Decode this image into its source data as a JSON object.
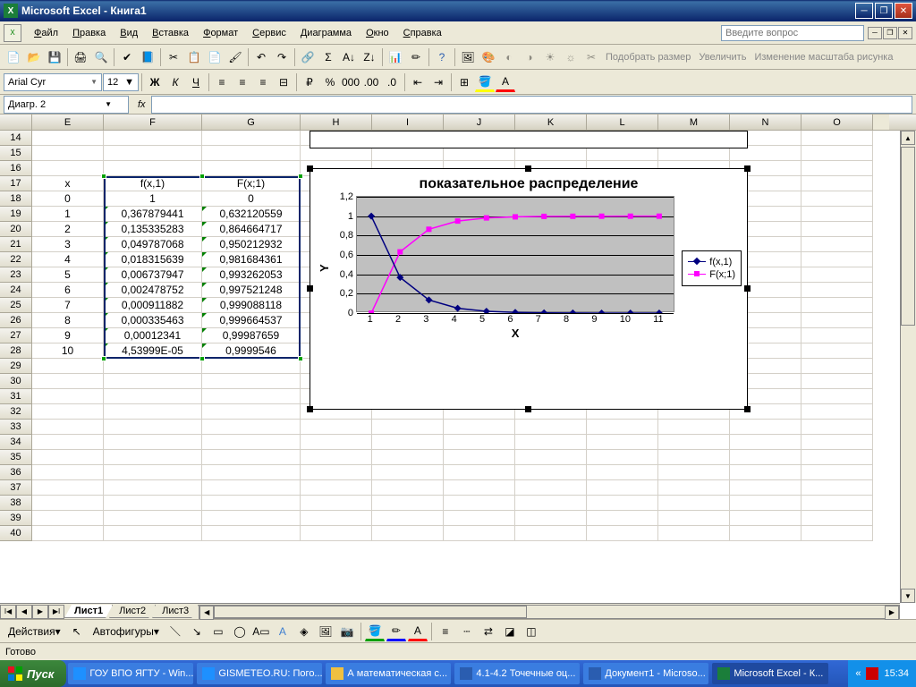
{
  "title": "Microsoft Excel - Книга1",
  "menus": [
    "Файл",
    "Правка",
    "Вид",
    "Вставка",
    "Формат",
    "Сервис",
    "Диаграмма",
    "Окно",
    "Справка"
  ],
  "help_placeholder": "Введите вопрос",
  "font_name": "Arial Cyr",
  "font_size": "12",
  "namebox": "Диагр. 2",
  "fx": "fx",
  "pic_labels": {
    "fit": "Подобрать размер",
    "enlarge": "Увеличить",
    "scale": "Изменение масштаба рисунка"
  },
  "columns": [
    "E",
    "F",
    "G",
    "H",
    "I",
    "J",
    "K",
    "L",
    "M",
    "N",
    "O"
  ],
  "rows": [
    14,
    15,
    16,
    17,
    18,
    19,
    20,
    21,
    22,
    23,
    24,
    25,
    26,
    27,
    28,
    29,
    30,
    31,
    32,
    33,
    34,
    35,
    36,
    37,
    38,
    39,
    40
  ],
  "table": {
    "header": {
      "e": "x",
      "f": "f(x,1)",
      "g": "F(x;1)"
    },
    "rows": [
      {
        "e": "0",
        "f": "1",
        "g": "0"
      },
      {
        "e": "1",
        "f": "0,367879441",
        "g": "0,632120559"
      },
      {
        "e": "2",
        "f": "0,135335283",
        "g": "0,864664717"
      },
      {
        "e": "3",
        "f": "0,049787068",
        "g": "0,950212932"
      },
      {
        "e": "4",
        "f": "0,018315639",
        "g": "0,981684361"
      },
      {
        "e": "5",
        "f": "0,006737947",
        "g": "0,993262053"
      },
      {
        "e": "6",
        "f": "0,002478752",
        "g": "0,997521248"
      },
      {
        "e": "7",
        "f": "0,000911882",
        "g": "0,999088118"
      },
      {
        "e": "8",
        "f": "0,000335463",
        "g": "0,999664537"
      },
      {
        "e": "9",
        "f": "0,00012341",
        "g": "0,99987659"
      },
      {
        "e": "10",
        "f": "4,53999E-05",
        "g": "0,9999546"
      }
    ]
  },
  "chart_data": {
    "type": "line",
    "title": "показательное распределение",
    "xlabel": "X",
    "ylabel": "Y",
    "ylim": [
      0,
      1.2
    ],
    "y_ticks": [
      0,
      0.2,
      0.4,
      0.6,
      0.8,
      1,
      1.2
    ],
    "y_tick_labels": [
      "0",
      "0,2",
      "0,4",
      "0,6",
      "0,8",
      "1",
      "1,2"
    ],
    "categories": [
      1,
      2,
      3,
      4,
      5,
      6,
      7,
      8,
      9,
      10,
      11
    ],
    "series": [
      {
        "name": "f(x,1)",
        "color": "#000080",
        "marker": "diamond",
        "values": [
          1,
          0.368,
          0.135,
          0.05,
          0.018,
          0.007,
          0.002,
          0.001,
          0.0003,
          0.0001,
          5e-05
        ]
      },
      {
        "name": "F(x;1)",
        "color": "#ff00ff",
        "marker": "square",
        "values": [
          0,
          0.632,
          0.865,
          0.95,
          0.982,
          0.993,
          0.998,
          0.999,
          0.9997,
          0.9999,
          0.99995
        ]
      }
    ]
  },
  "sheets": [
    "Лист1",
    "Лист2",
    "Лист3"
  ],
  "active_sheet": 0,
  "draw": {
    "actions": "Действия",
    "autoshapes": "Автофигуры"
  },
  "status": "Готово",
  "taskbar": {
    "start": "Пуск",
    "items": [
      {
        "label": "ГОУ ВПО ЯГТУ - Win...",
        "icon": "ie"
      },
      {
        "label": "GISMETEO.RU: Пого...",
        "icon": "ie"
      },
      {
        "label": "А математическая с...",
        "icon": "folder"
      },
      {
        "label": "4.1-4.2 Точечные оц...",
        "icon": "word"
      },
      {
        "label": "Документ1 - Microso...",
        "icon": "word"
      },
      {
        "label": "Microsoft Excel - К...",
        "icon": "excel",
        "active": true
      }
    ],
    "tray_chevron": "«",
    "clock": "15:34"
  }
}
